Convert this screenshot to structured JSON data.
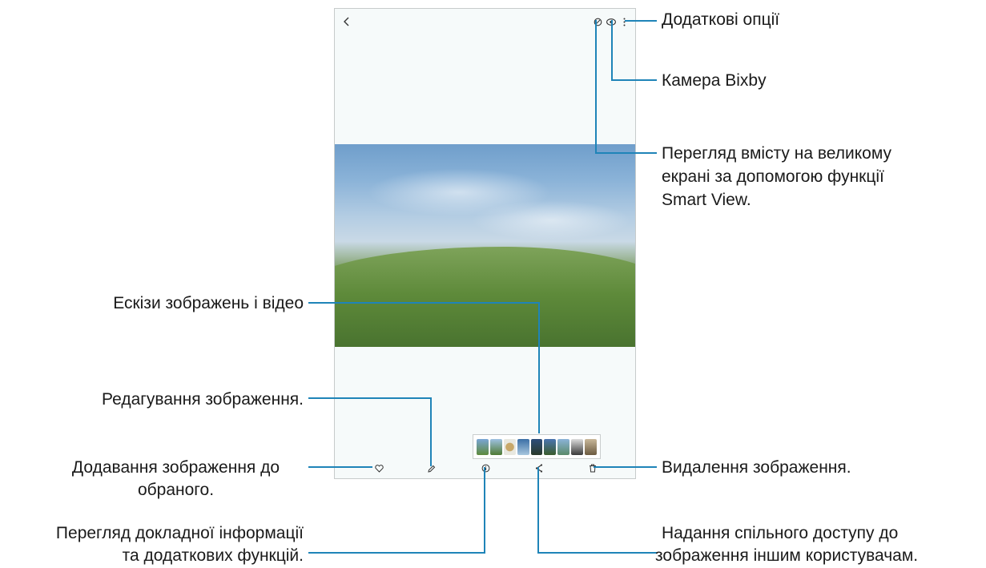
{
  "annotations": {
    "more_options": "Додаткові опції",
    "bixby_vision": "Камера Bixby",
    "smart_view_line1": "Перегляд вмісту на великому",
    "smart_view_line2": "екрані за допомогою функції",
    "smart_view_line3": "Smart View.",
    "thumbnails": "Ескізи зображень і відео",
    "edit": "Редагування зображення.",
    "favorite_line1": "Додавання зображення до",
    "favorite_line2": "обраного.",
    "delete": "Видалення зображення.",
    "details_line1": "Перегляд докладної інформації",
    "details_line2": "та додаткових функцій.",
    "share_line1": "Надання спільного доступу до",
    "share_line2": "зображення іншим користувачам."
  },
  "device_icons": {
    "back": "back-arrow-icon",
    "smart_view": "smart-view-icon",
    "bixby": "eye-icon",
    "more": "more-options-icon",
    "favorite": "heart-icon",
    "edit": "pencil-icon",
    "details": "info-icon",
    "share": "share-icon",
    "delete": "trash-icon"
  },
  "colors": {
    "callout_line": "#1f84b8"
  }
}
